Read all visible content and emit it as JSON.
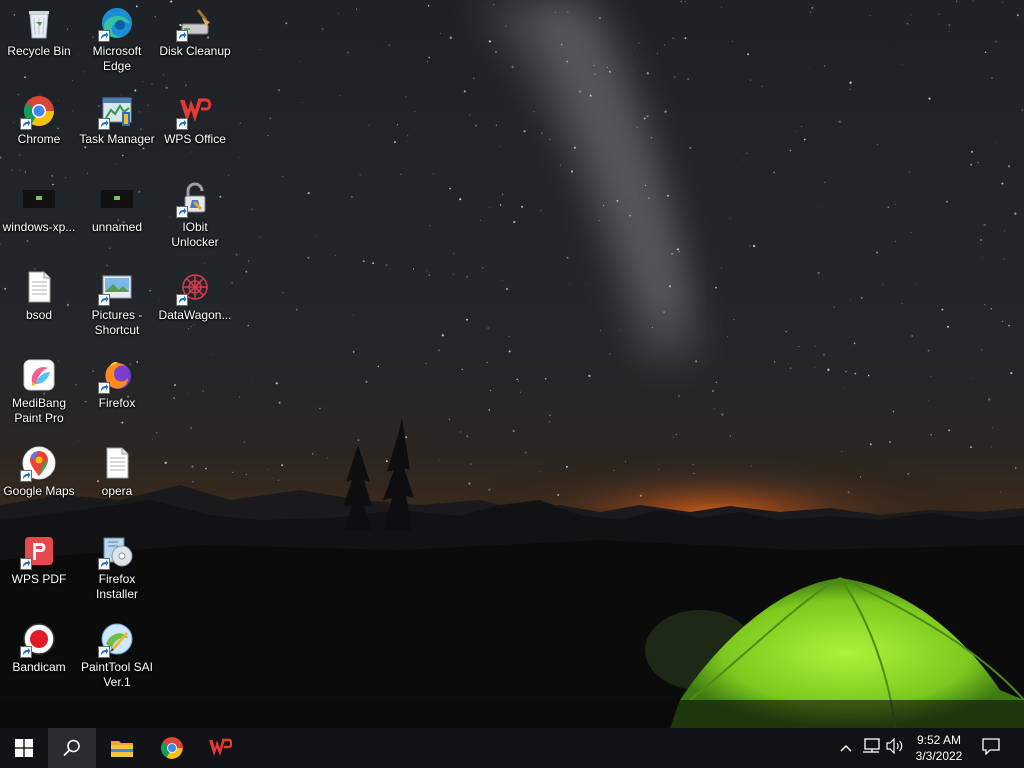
{
  "desktop": {
    "icons": [
      {
        "label": "Recycle Bin",
        "icon": "recycle-bin-icon"
      },
      {
        "label": "Microsoft\nEdge",
        "icon": "edge-icon"
      },
      {
        "label": "Disk Cleanup",
        "icon": "disk-cleanup-icon"
      },
      {
        "label": "Chrome",
        "icon": "chrome-icon"
      },
      {
        "label": "Task Manager",
        "icon": "task-manager-icon"
      },
      {
        "label": "WPS Office",
        "icon": "wps-office-icon"
      },
      {
        "label": "windows-xp...",
        "icon": "image-file-icon"
      },
      {
        "label": "unnamed",
        "icon": "image-file-icon"
      },
      {
        "label": "IObit\nUnlocker",
        "icon": "iobit-unlocker-icon"
      },
      {
        "label": "bsod",
        "icon": "text-file-icon"
      },
      {
        "label": "Pictures -\nShortcut",
        "icon": "pictures-folder-icon"
      },
      {
        "label": "DataWagon...",
        "icon": "datawagon-icon"
      },
      {
        "label": "MediBang\nPaint Pro",
        "icon": "medibang-icon"
      },
      {
        "label": "Firefox",
        "icon": "firefox-icon"
      },
      {
        "label": "Google Maps",
        "icon": "google-maps-icon"
      },
      {
        "label": "opera",
        "icon": "text-file-icon"
      },
      {
        "label": "WPS PDF",
        "icon": "wps-pdf-icon"
      },
      {
        "label": "Firefox\nInstaller",
        "icon": "installer-icon"
      },
      {
        "label": "Bandicam",
        "icon": "bandicam-icon"
      },
      {
        "label": "PaintTool SAI\nVer.1",
        "icon": "painttool-sai-icon"
      }
    ]
  },
  "taskbar": {
    "start": "windows-start-icon",
    "search": "search-icon",
    "pinned": [
      "file-explorer-icon",
      "chrome-icon",
      "wps-office-icon"
    ],
    "tray": [
      "chevron-up-icon",
      "network-icon",
      "volume-icon"
    ],
    "clock": {
      "time": "9:52 AM",
      "date": "3/3/2022"
    },
    "notifications": "notification-icon"
  }
}
